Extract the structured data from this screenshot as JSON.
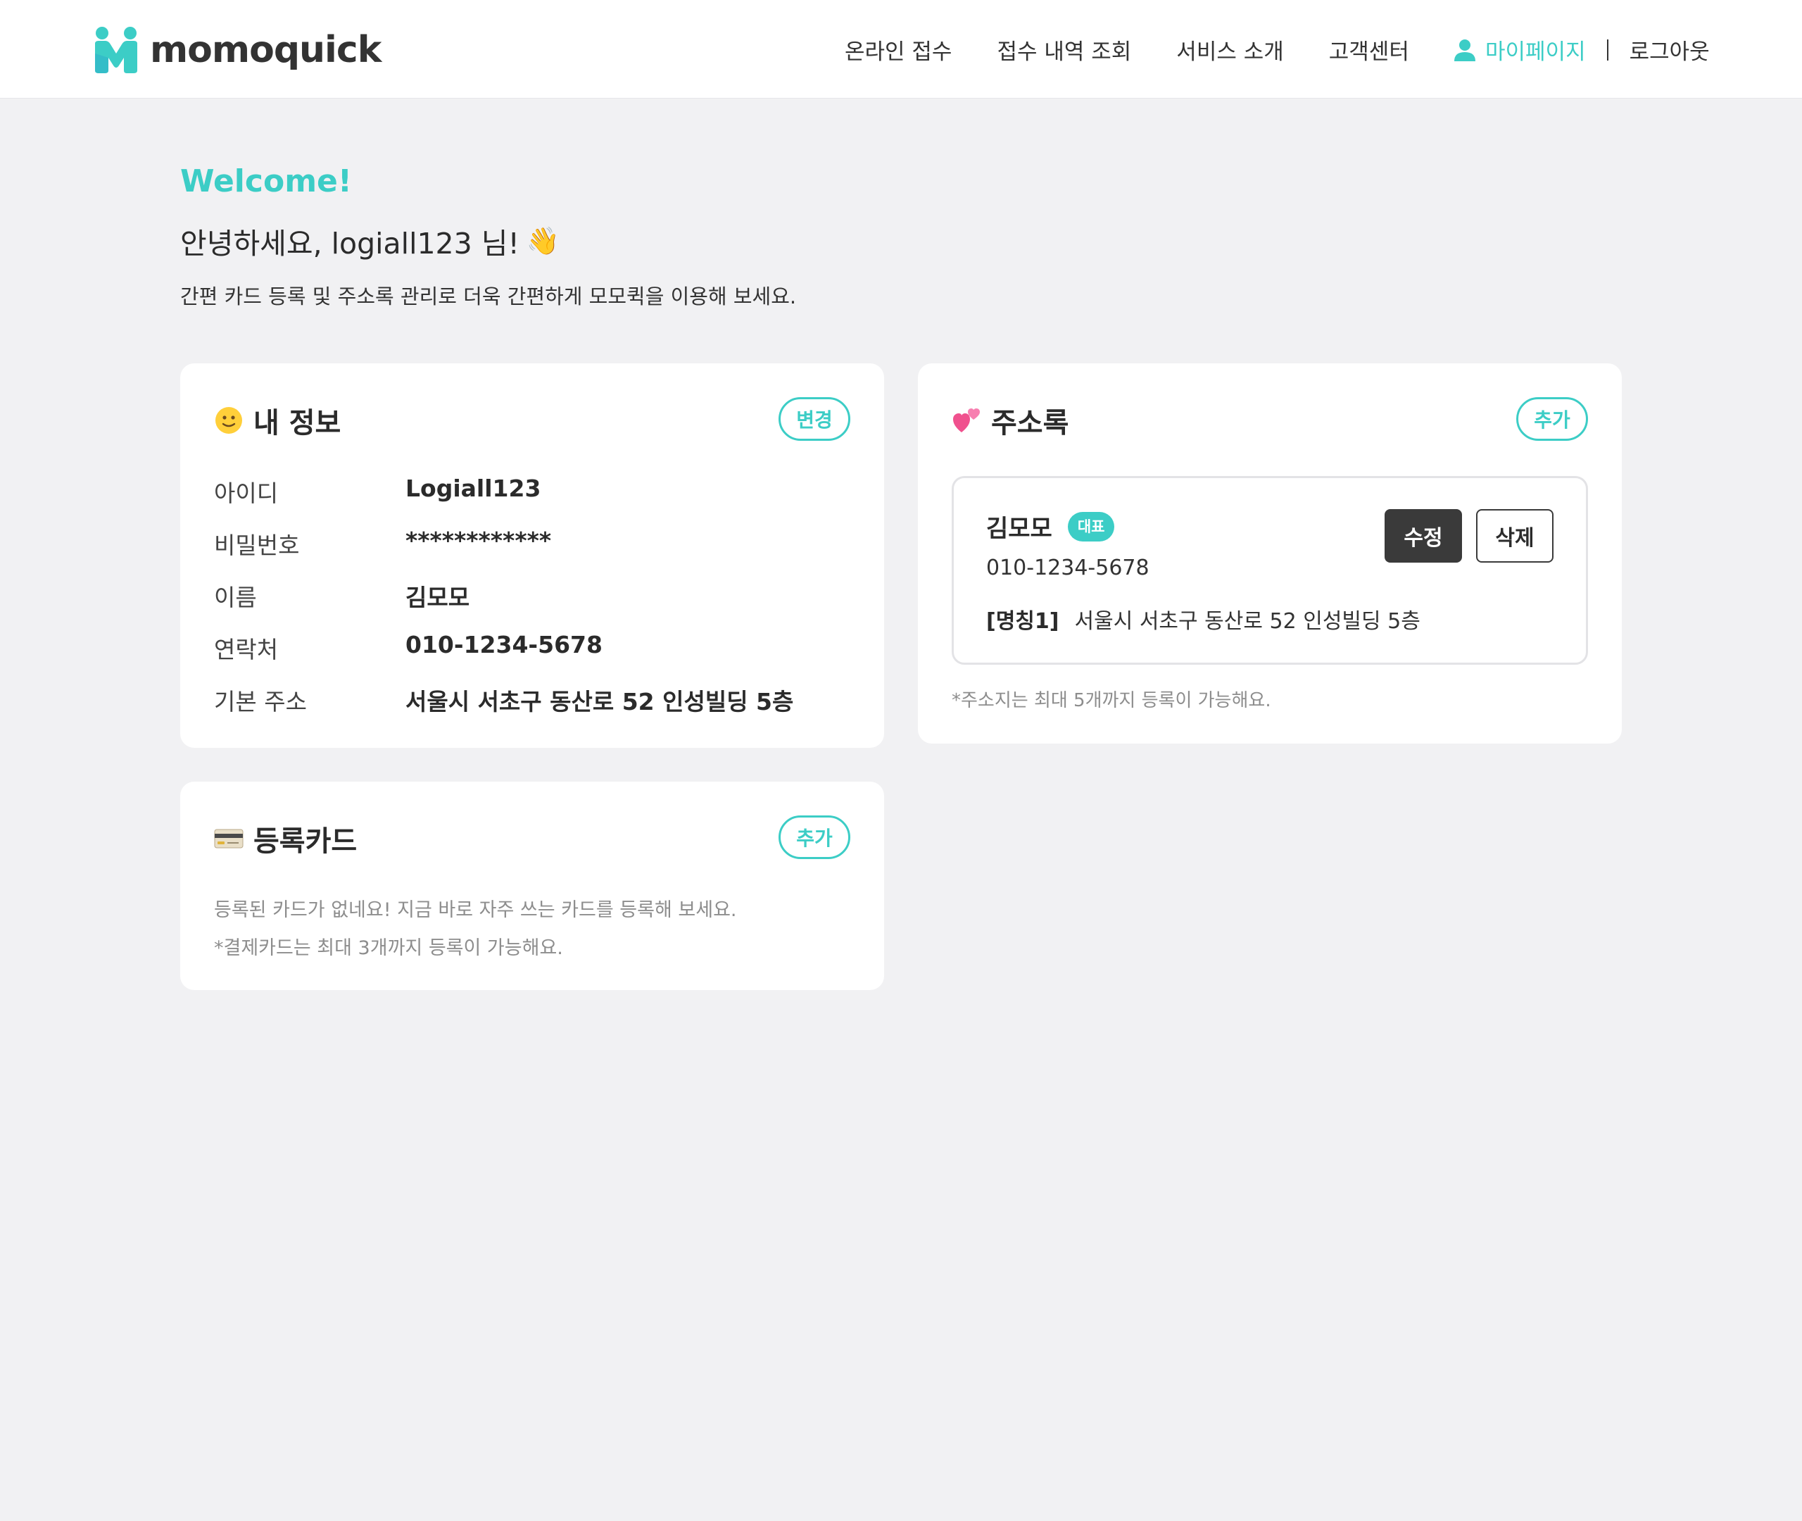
{
  "header": {
    "logo_text": "momoquick",
    "nav": [
      "온라인 접수",
      "접수 내역 조회",
      "서비스 소개",
      "고객센터"
    ],
    "mypage_label": "마이페이지",
    "logout_label": "로그아웃"
  },
  "welcome": {
    "title": "Welcome!",
    "greeting": "안녕하세요, logiall123 님!",
    "greeting_emoji": "👋",
    "subtitle": "간편 카드 등록 및 주소록 관리로 더욱 간편하게 모모퀵을 이용해 보세요."
  },
  "my_info": {
    "title": "내 정보",
    "emoji": "slightly-smiling-face-icon",
    "change_label": "변경",
    "rows": [
      {
        "label": "아이디",
        "value": "Logiall123"
      },
      {
        "label": "비밀번호",
        "value": "************"
      },
      {
        "label": "이름",
        "value": "김모모"
      },
      {
        "label": "연락처",
        "value": "010-1234-5678"
      },
      {
        "label": "기본 주소",
        "value": "서울시 서초구 동산로 52 인성빌딩 5층"
      }
    ]
  },
  "address_book": {
    "title": "주소록",
    "emoji": "two-hearts-icon",
    "add_label": "추가",
    "entries": [
      {
        "name": "김모모",
        "badge": "대표",
        "phone": "010-1234-5678",
        "nickname": "[명칭1]",
        "address": "서울시 서초구 동산로 52 인성빌딩 5층",
        "edit_label": "수정",
        "delete_label": "삭제"
      }
    ],
    "note": "*주소지는 최대 5개까지 등록이 가능해요."
  },
  "cards": {
    "title": "등록카드",
    "emoji": "credit-card-icon",
    "add_label": "추가",
    "empty_text": "등록된 카드가 없네요! 지금 바로 자주 쓰는 카드를 등록해 보세요.",
    "note": "*결제카드는 최대 3개까지 등록이 가능해요."
  },
  "colors": {
    "accent": "#3ccdc6",
    "background": "#f1f1f3",
    "dark_button": "#3a3a3a"
  }
}
